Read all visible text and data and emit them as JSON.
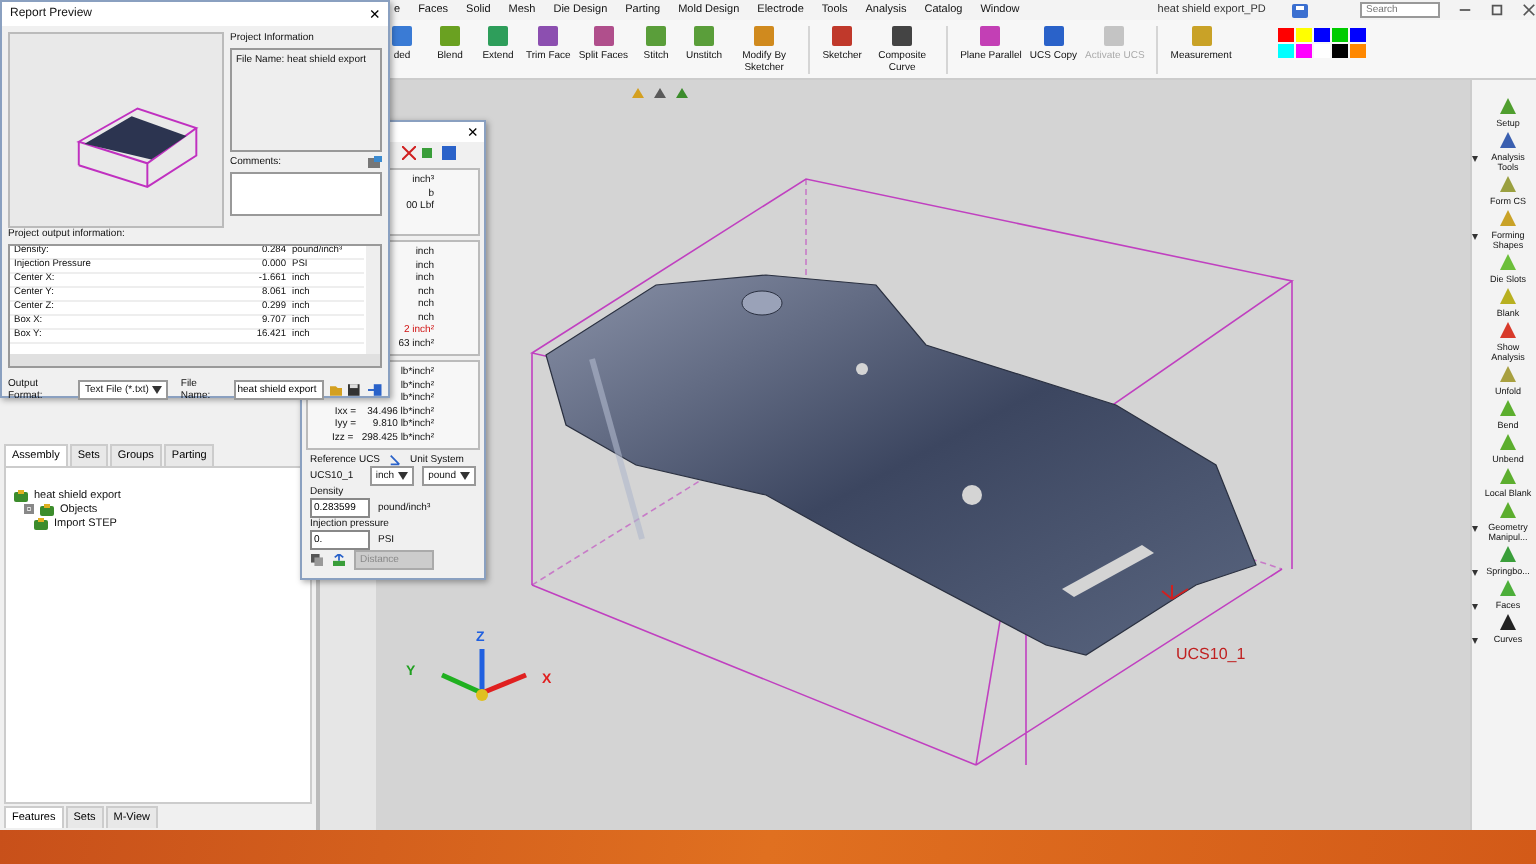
{
  "menu_bar": {
    "items": [
      "e",
      "Faces",
      "Solid",
      "Mesh",
      "Die Design",
      "Parting",
      "Mold Design",
      "Electrode",
      "Tools",
      "Analysis",
      "Catalog",
      "Window"
    ]
  },
  "window": {
    "title": "heat shield export_PD"
  },
  "search": {
    "placeholder": "Search"
  },
  "ribbon": {
    "tools": [
      {
        "label": "ded",
        "disabled": false,
        "color": "#3a7bd5"
      },
      {
        "label": "Blend",
        "disabled": false,
        "color": "#6aa121"
      },
      {
        "label": "Extend",
        "disabled": false,
        "color": "#2e9e5b"
      },
      {
        "label": "Trim Face",
        "disabled": false,
        "color": "#8c4fb0"
      },
      {
        "label": "Split Faces",
        "disabled": false,
        "color": "#b04f8c"
      },
      {
        "label": "Stitch",
        "disabled": false,
        "color": "#5a9e3a"
      },
      {
        "label": "Unstitch",
        "disabled": false,
        "color": "#5a9e3a"
      },
      {
        "label": "Modify By Sketcher",
        "disabled": false,
        "color": "#d08a1e"
      },
      {
        "label": "Sketcher",
        "disabled": false,
        "color": "#c0392b"
      },
      {
        "label": "Composite Curve",
        "disabled": false,
        "color": "#444444"
      },
      {
        "label": "Plane Parallel",
        "disabled": false,
        "color": "#c33fb5"
      },
      {
        "label": "UCS Copy",
        "disabled": false,
        "color": "#2a62c9"
      },
      {
        "label": "Activate UCS",
        "disabled": true,
        "color": "#c4c4c4"
      },
      {
        "label": "Measurement",
        "disabled": false,
        "color": "#c9a227"
      }
    ]
  },
  "report_preview": {
    "title": "Report Preview",
    "close": "×",
    "project_information_label": "Project Information",
    "project_information": "File Name: heat shield export",
    "comments_label": "Comments:",
    "output_label": "Project output information:",
    "rows": [
      {
        "name": "Density:",
        "value": "0.284",
        "unit": "pound/inch³"
      },
      {
        "name": "Injection Pressure",
        "value": "0.000",
        "unit": "PSI"
      },
      {
        "name": "Center X:",
        "value": "-1.661",
        "unit": "inch"
      },
      {
        "name": "Center Y:",
        "value": "8.061",
        "unit": "inch"
      },
      {
        "name": "Center Z:",
        "value": "0.299",
        "unit": "inch"
      },
      {
        "name": "Box X:",
        "value": "9.707",
        "unit": "inch"
      },
      {
        "name": "Box Y:",
        "value": "16.421",
        "unit": "inch"
      }
    ],
    "output_format_label": "Output Format:",
    "output_format": "Text File (*.txt)",
    "file_name_label": "File Name:",
    "file_name": "heat shield export"
  },
  "properties_panel": {
    "close": "×",
    "sections": [
      {
        "lines": [
          {
            "text": "inch³",
            "alert": false
          },
          {
            "text": "b",
            "alert": false
          },
          {
            "text": "00 Lbf",
            "alert": false
          }
        ]
      },
      {
        "lines": [
          {
            "text": "inch",
            "alert": false
          },
          {
            "text": "inch",
            "alert": false
          },
          {
            "text": "inch",
            "alert": false
          },
          {
            "text": "nch",
            "alert": false
          },
          {
            "text": "nch",
            "alert": false
          },
          {
            "text": "nch",
            "alert": false
          },
          {
            "text": "2 inch²",
            "alert": true
          },
          {
            "text": "63 inch²",
            "alert": false
          }
        ]
      },
      {
        "lines": [
          {
            "text": "lb*inch²",
            "alert": false
          },
          {
            "text": "lb*inch²",
            "alert": false
          },
          {
            "text": "lb*inch²",
            "alert": false
          },
          {
            "text": "Ixx =    34.496 lb*inch²",
            "alert": false
          },
          {
            "text": "Iyy =      9.810 lb*inch²",
            "alert": false
          },
          {
            "text": "Izz =   298.425 lb*inch²",
            "alert": false
          }
        ]
      }
    ],
    "reference_ucs_label": "Reference UCS",
    "reference_ucs": "UCS10_1",
    "unit_system_label": "Unit System",
    "length_unit": "inch",
    "mass_unit": "pound",
    "density_label": "Density",
    "density": "0.283599",
    "density_unit": "pound/inch³",
    "pressure_label": "Injection pressure",
    "pressure": "0.",
    "pressure_unit": "PSI",
    "measure_mode": "Distance"
  },
  "tree_tabs": [
    {
      "label": "Assembly",
      "selected": true
    },
    {
      "label": "Sets",
      "selected": false
    },
    {
      "label": "Groups",
      "selected": false
    },
    {
      "label": "Parting",
      "selected": false
    }
  ],
  "tree": [
    {
      "label": "heat shield export",
      "children": [
        {
          "label": "Objects",
          "expanded": true,
          "children": [
            {
              "label": "Import STEP"
            }
          ]
        }
      ]
    }
  ],
  "bottom_tabs": [
    {
      "label": "Features",
      "selected": true
    },
    {
      "label": "Sets",
      "selected": false
    },
    {
      "label": "M-View",
      "selected": false
    }
  ],
  "viewport": {
    "ucs_label": "UCS10_1",
    "axes": {
      "x": "X",
      "y": "Y",
      "z": "Z"
    }
  },
  "right_toolbar": [
    {
      "label": "Setup",
      "dropdown": false,
      "color": "#4f9e2e"
    },
    {
      "label": "Analysis Tools",
      "dropdown": true,
      "color": "#3a5fb0"
    },
    {
      "label": "Form CS",
      "dropdown": false,
      "color": "#9aa040"
    },
    {
      "label": "Forming Shapes",
      "dropdown": true,
      "color": "#c9a227"
    },
    {
      "label": "Die Slots",
      "dropdown": false,
      "color": "#6cbf3a"
    },
    {
      "label": "Blank",
      "dropdown": false,
      "color": "#b8b020"
    },
    {
      "label": "Show Analysis",
      "dropdown": false,
      "color": "#d83a2a"
    },
    {
      "label": "Unfold",
      "dropdown": false,
      "color": "#a8a040"
    },
    {
      "label": "Bend",
      "dropdown": false,
      "color": "#5cae2e"
    },
    {
      "label": "Unbend",
      "dropdown": false,
      "color": "#5cae2e"
    },
    {
      "label": "Local Blank",
      "dropdown": false,
      "color": "#5cae2e"
    },
    {
      "label": "Geometry Manipul...",
      "dropdown": true,
      "color": "#5cae2e"
    },
    {
      "label": "Springbo...",
      "dropdown": true,
      "color": "#3a9e3a"
    },
    {
      "label": "Faces",
      "dropdown": true,
      "color": "#4cae3a"
    },
    {
      "label": "Curves",
      "dropdown": true,
      "color": "#222222"
    }
  ]
}
